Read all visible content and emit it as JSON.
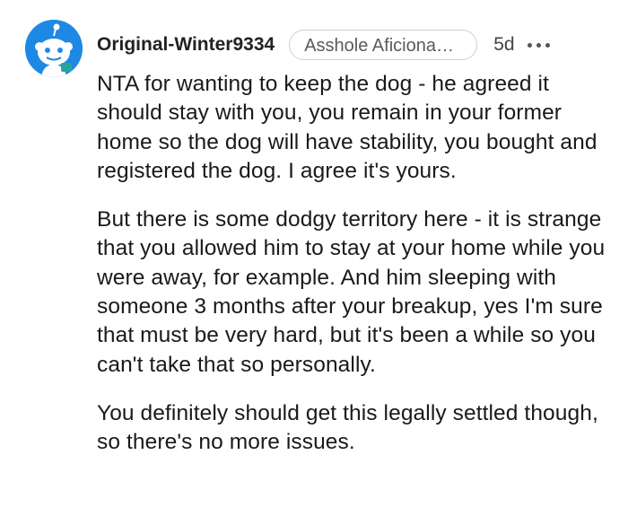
{
  "comment": {
    "username": "Original-Winter9334",
    "flair": "Asshole Aficionad…",
    "age": "5d",
    "avatar_icon": "reddit-snoo-icon",
    "more_icon": "more-options-icon",
    "paragraphs": [
      "NTA for wanting to keep the dog - he agreed it should stay with you, you remain in your former home so the dog will have stability, you bought and registered the dog. I agree it's yours.",
      "But there is some dodgy territory here - it is strange that you allowed him to stay at your home while you were away, for example. And him sleeping with someone 3 months after your breakup, yes I'm sure that must be very hard, but it's been a while so you can't take that so personally.",
      "You definitely should get this legally settled though, so there's no more issues."
    ],
    "colors": {
      "avatar_bg": "#1e88e5",
      "text": "#1a1a1a",
      "flair_border": "#cfcfcf"
    }
  }
}
